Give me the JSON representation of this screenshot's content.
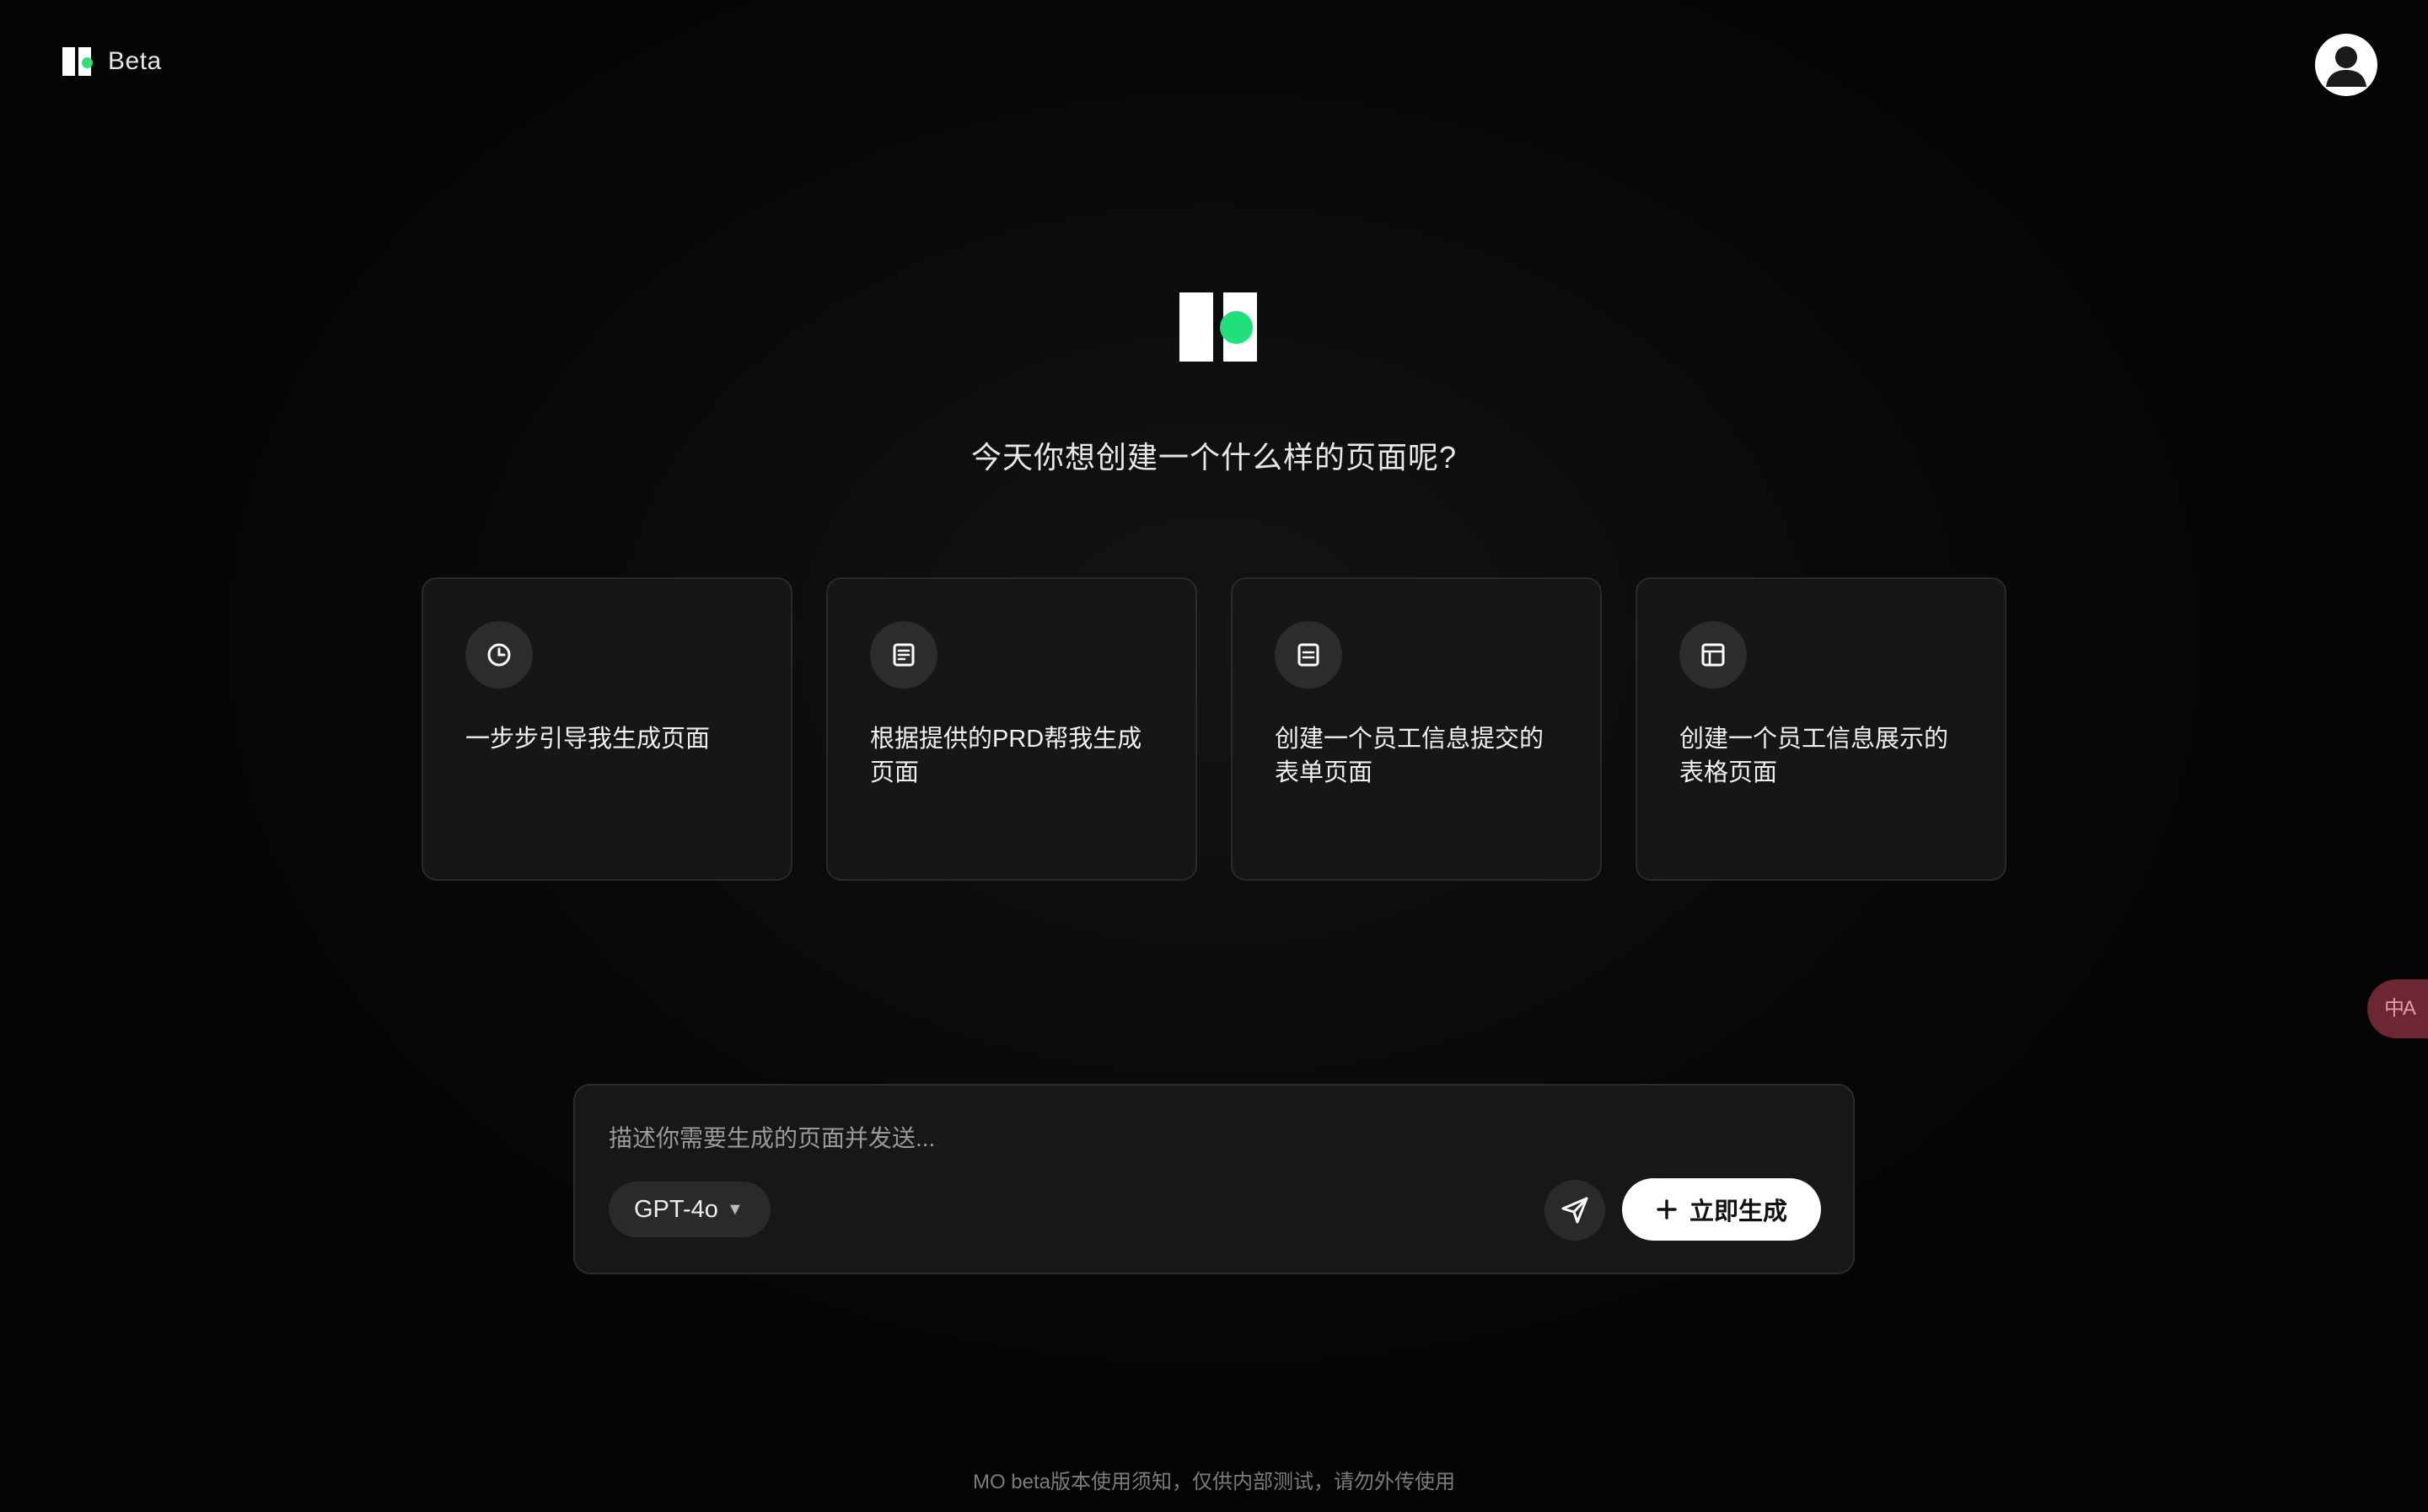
{
  "header": {
    "brand_label": "Beta",
    "accent_color": "#2ee07a"
  },
  "hero": {
    "title": "今天你想创建一个什么样的页面呢?"
  },
  "cards": [
    {
      "icon": "clock-icon",
      "text": "一步步引导我生成页面"
    },
    {
      "icon": "document-icon",
      "text": "根据提供的PRD帮我生成页面"
    },
    {
      "icon": "form-icon",
      "text": "创建一个员工信息提交的表单页面"
    },
    {
      "icon": "table-icon",
      "text": "创建一个员工信息展示的表格页面"
    }
  ],
  "composer": {
    "placeholder": "描述你需要生成的页面并发送...",
    "model": "GPT-4o",
    "generate_label": "立即生成"
  },
  "translate": {
    "glyph": "中A"
  },
  "footer": {
    "notice": "MO beta版本使用须知，仅供内部测试，请勿外传使用"
  }
}
